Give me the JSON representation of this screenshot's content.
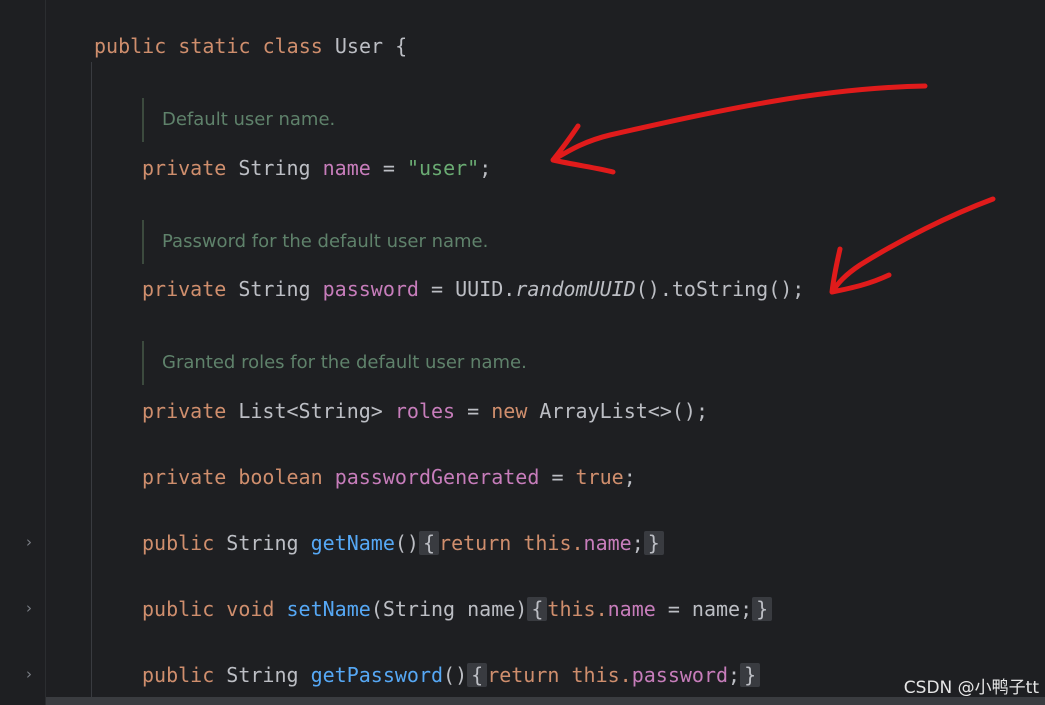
{
  "code": {
    "class_decl": {
      "kw1": "public",
      "kw2": "static",
      "kw3": "class",
      "name": "User",
      "brace": "{"
    },
    "doc_name": "Default user name.",
    "name_line": {
      "kw": "private",
      "type": "String",
      "field": "name",
      "eq": "=",
      "value": "\"user\"",
      "end": ";"
    },
    "doc_password": "Password for the default user name.",
    "password_line": {
      "kw": "private",
      "type": "String",
      "field": "password",
      "eq": "=",
      "cls": "UUID.",
      "method": "randomUUID",
      "call": "().toString();"
    },
    "doc_roles": "Granted roles for the default user name.",
    "roles_line": {
      "kw": "private",
      "type": "List<String>",
      "field": "roles",
      "eq": "=",
      "new": "new",
      "rest": "ArrayList<>();"
    },
    "generated_line": {
      "kw": "private",
      "type": "boolean",
      "field": "passwordGenerated",
      "eq": "=",
      "value": "true",
      "end": ";"
    },
    "getname_line": {
      "kw": "public",
      "type": "String",
      "method": "getName",
      "parens": "()",
      "open": "{",
      "ret": "return",
      "this": "this.",
      "field": "name",
      "semi": ";",
      "close": "}"
    },
    "setname_line": {
      "kw": "public",
      "type": "void",
      "method": "setName",
      "params": "(String name)",
      "open": "{",
      "this": "this.",
      "field": "name",
      "rest": "= name;",
      "close": "}"
    },
    "getpassword_line": {
      "kw": "public",
      "type": "String",
      "method": "getPassword",
      "parens": "()",
      "open": "{",
      "ret": "return",
      "this": "this.",
      "field": "password",
      "semi": ";",
      "close": "}"
    }
  },
  "gutter": {
    "fold_symbol": "›"
  },
  "watermark": "CSDN @小鸭子tt",
  "colors": {
    "background": "#1e1f22",
    "keyword": "#cf8e6d",
    "field": "#c77dbb",
    "string": "#6aab73",
    "method": "#56a8f5",
    "doc": "#5f826b",
    "annotation_arrow": "#e01b1b"
  },
  "annotations": [
    "red-hand-drawn-arrow",
    "red-hand-drawn-arrow"
  ]
}
